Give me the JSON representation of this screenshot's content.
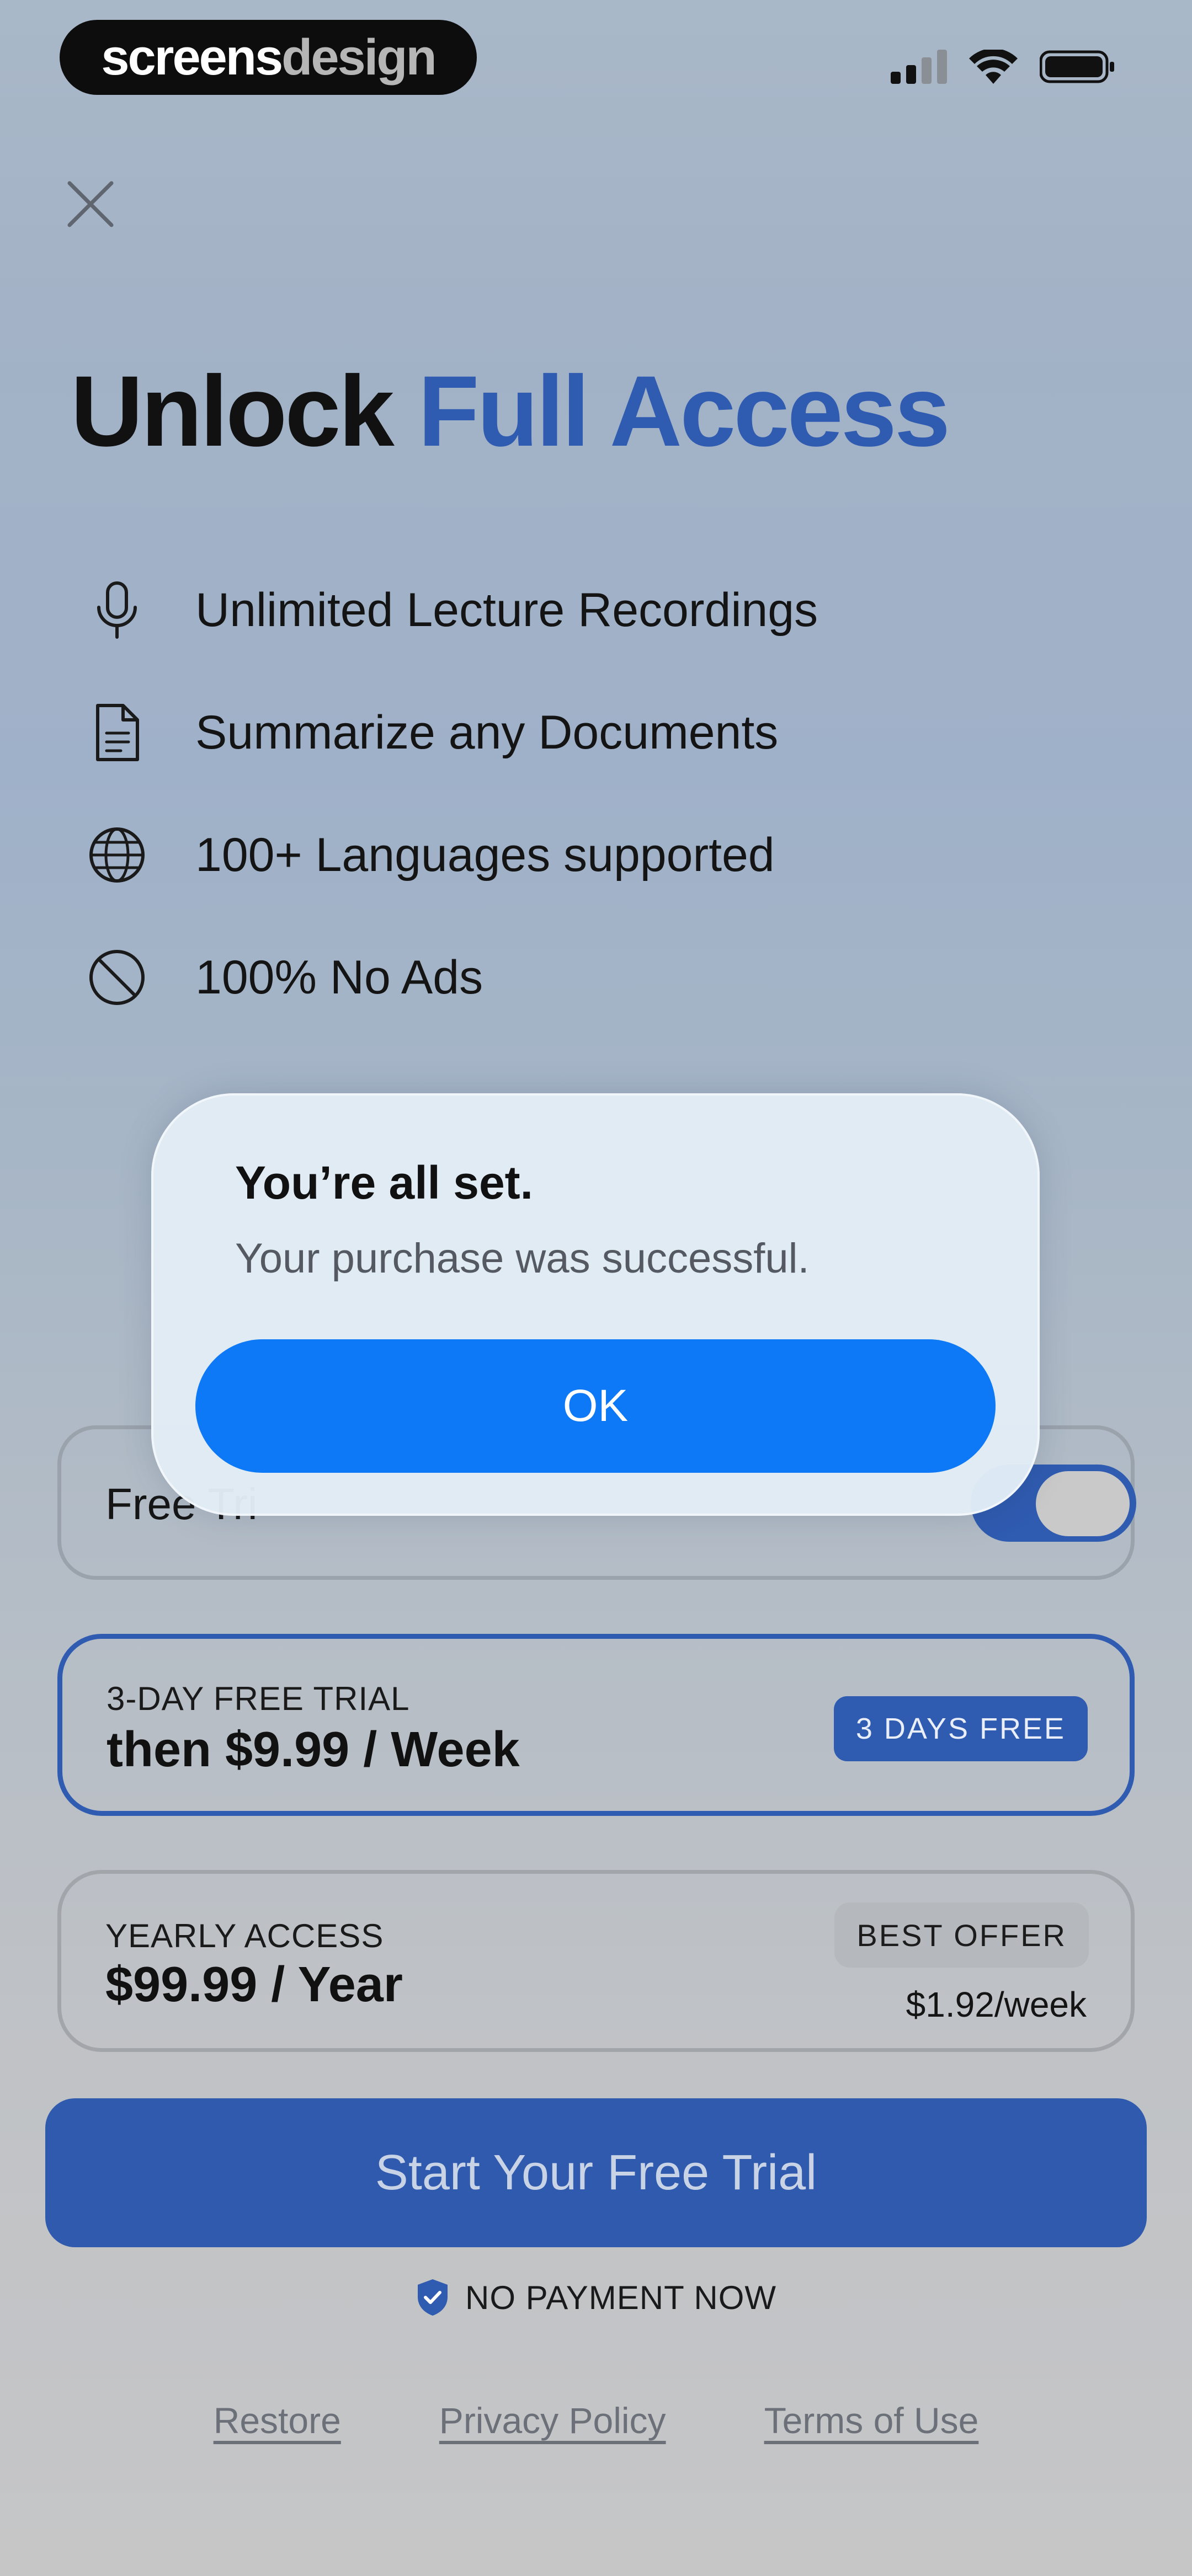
{
  "status_bar": {
    "brand_part1": "screens",
    "brand_part2": "design",
    "icons": [
      "cellular-signal-icon",
      "wifi-icon",
      "battery-icon"
    ]
  },
  "header": {
    "title_part1": "Unlock ",
    "title_accent": "Full Access",
    "close_icon": "close-icon"
  },
  "features": [
    {
      "icon": "microphone-icon",
      "label": "Unlimited Lecture Recordings"
    },
    {
      "icon": "document-icon",
      "label": "Summarize any Documents"
    },
    {
      "icon": "globe-icon",
      "label": "100+ Languages supported"
    },
    {
      "icon": "no-ads-icon",
      "label": "100% No Ads"
    }
  ],
  "trial_toggle": {
    "label": "Free Trial Enabled",
    "visible_label": "Free Tri",
    "on": true
  },
  "plans": [
    {
      "subtitle": "3-DAY FREE TRIAL",
      "price": "then $9.99 / Week",
      "badge": "3 DAYS FREE",
      "selected": true
    },
    {
      "subtitle": "YEARLY ACCESS",
      "price": "$99.99 / Year",
      "badge": "BEST OFFER",
      "per_week": "$1.92/week",
      "selected": false
    }
  ],
  "cta": {
    "label": "Start Your Free Trial",
    "note": "NO PAYMENT NOW"
  },
  "footer_links": {
    "restore": "Restore",
    "privacy": "Privacy Policy",
    "terms": "Terms of Use"
  },
  "alert": {
    "title": "You’re all set.",
    "message": "Your purchase was successful.",
    "ok_label": "OK"
  },
  "colors": {
    "accent": "#2f5bb0",
    "alert_button": "#0e79f6",
    "background": "#a9b8c8"
  }
}
